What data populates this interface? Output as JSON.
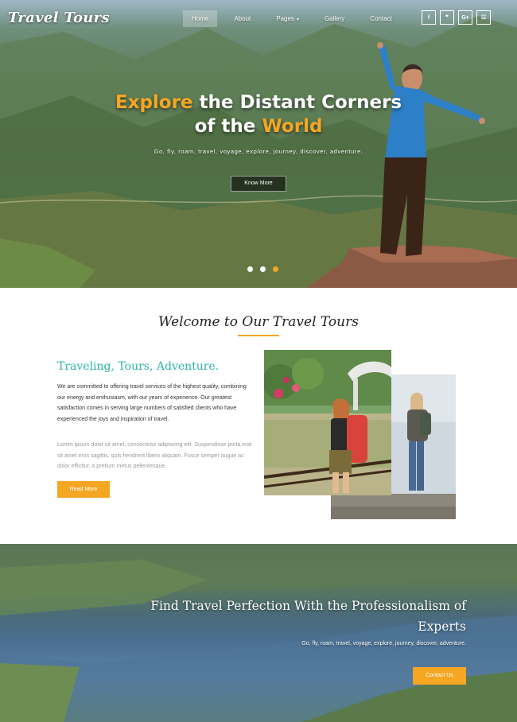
{
  "brand": {
    "logo": "Travel Tours"
  },
  "nav": {
    "items": [
      {
        "label": "Home",
        "active": true
      },
      {
        "label": "About"
      },
      {
        "label": "Pages",
        "dropdown": true
      },
      {
        "label": "Gallery"
      },
      {
        "label": "Contact"
      }
    ]
  },
  "social": [
    {
      "icon": "facebook-icon",
      "glyph": "f"
    },
    {
      "icon": "twitter-icon",
      "glyph": "❞"
    },
    {
      "icon": "google-plus-icon",
      "glyph": "G+"
    },
    {
      "icon": "rss-icon",
      "glyph": "☷"
    }
  ],
  "hero": {
    "line1_highlight": "Explore",
    "line1_rest": " the Distant Corners",
    "line2_rest": "of the ",
    "line2_highlight": "World",
    "subtitle": "Go, fly, roam, travel, voyage, explore, journey, discover, adventure.",
    "button": "Know More",
    "slides": 3,
    "active_slide": 3
  },
  "welcome": {
    "title": "Welcome to Our Travel Tours",
    "heading": "Traveling, Tours, Adventure.",
    "para1": "We are committed to offering travel services of the highest quality, combining our energy and enthusiasm, with our years of experience. Our greatest satisfaction comes in serving large numbers of satisfied clients who have experienced the joys and inspiration of travel.",
    "para2": "Lorem ipsum dolor sit amet, consectetur adipiscing elit. Suspendisse porta erat sit amet eros sagittis, quis hendrerit libero aliquam. Fusce semper augue ac dolor efficitur, a pretium metus pellentesque.",
    "button": "Read More"
  },
  "cta": {
    "title": "Find Travel Perfection With the Professionalism of Experts",
    "subtitle": "Go, fly, roam, travel, voyage, explore, journey, discover, adventure.",
    "button": "Contact Us"
  },
  "colors": {
    "accent": "#f5a623",
    "teal": "#2bb5a8"
  }
}
